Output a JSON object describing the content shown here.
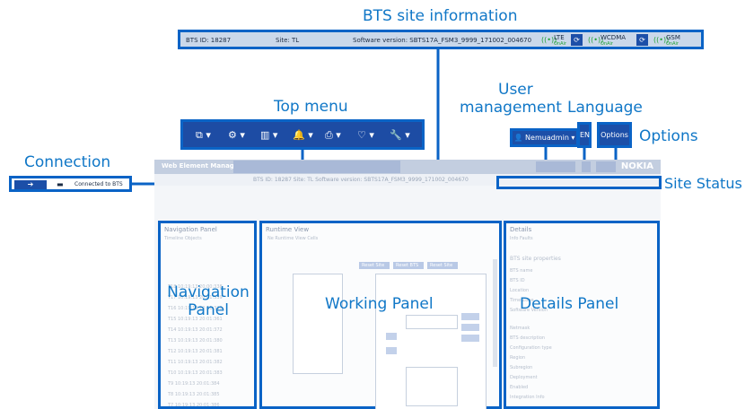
{
  "callouts": {
    "bts_site_info": "BTS site information",
    "top_menu": "Top menu",
    "user_management_line1": "User",
    "user_management_line2": "management",
    "language": "Language",
    "options": "Options",
    "connection": "Connection",
    "site_status": "Site Status",
    "navigation_panel_line1": "Navigation",
    "navigation_panel_line2": "Panel",
    "working_panel": "Working Panel",
    "details_panel": "Details Panel"
  },
  "bts_bar": {
    "bts_id": "BTS ID:  18287",
    "site": "Site:  TL",
    "software_version": "Software version:  SBTS17A_FSM3_9999_171002_004670",
    "radios": [
      {
        "name": "LTE",
        "state": "OnAir"
      },
      {
        "name": "WCDMA",
        "state": "OnAir"
      },
      {
        "name": "GSM",
        "state": "OnAir"
      }
    ],
    "radio_icon": "((•))",
    "refresh_icon": "⟳"
  },
  "top_menu_items": [
    "⧉ ▾",
    "⚙ ▾",
    "▥ ▾",
    "🔔 ▾",
    "⎙ ▾",
    "♡ ▾",
    "🔧 ▾"
  ],
  "user_button": "👤 Nemuadmin ▾",
  "language_button": "EN",
  "options_button": "Options",
  "connection_bar": {
    "connect_icon": "➔",
    "folder_icon": "▬",
    "status": "Connected to BTS"
  },
  "screenshot": {
    "app_title": "Web Element Manager",
    "brand": "NOKIA",
    "nav_title": "Navigation Panel",
    "nav_tabs": "Timeline   Objects",
    "working_title": "Runtime View",
    "working_tabs": "Ne Runtime View          Cells",
    "details_title": "Details",
    "details_tabs": "Info          Faults",
    "details_section": "BTS site properties",
    "details_rows": [
      "BTS name",
      "BTS ID",
      "Location",
      "Time Zone",
      "Software Version",
      "",
      "Netmask",
      "BTS description",
      "Configuration type",
      "Region",
      "Subregion",
      "Deployment",
      "Enabled",
      "Integration Info",
      "Target installation Info",
      "",
      "Preferences"
    ],
    "table_rows": [
      "T18  10:19:13 20:00:338",
      "T17  10:19:13 20:01:339",
      "T16  10:19:13 20:01:330",
      "T15  10:19:13 20:01:361",
      "T14  10:19:13 20:01:372",
      "T13  10:19:13 20:01:380",
      "T12  10:19:13 20:01:381",
      "T11  10:19:13 20:01:382",
      "T10  10:19:13 20:01:383",
      "T9   10:19:13 20:01:384",
      "T8   10:19:13 20:01:385",
      "T7   10:19:13 20:01:386",
      "T6   10:19:13 20:01:387",
      "T5   10:19:13 20:01:388",
      "T4   10:19:13 20:01:389"
    ],
    "work_buttons": [
      "Reset Site",
      "Reset BTS",
      "Reset Site"
    ],
    "status_row": "BTS ID: 18287      Site: TL      Software version: SBTS17A_FSM3_9999_171002_004670"
  }
}
